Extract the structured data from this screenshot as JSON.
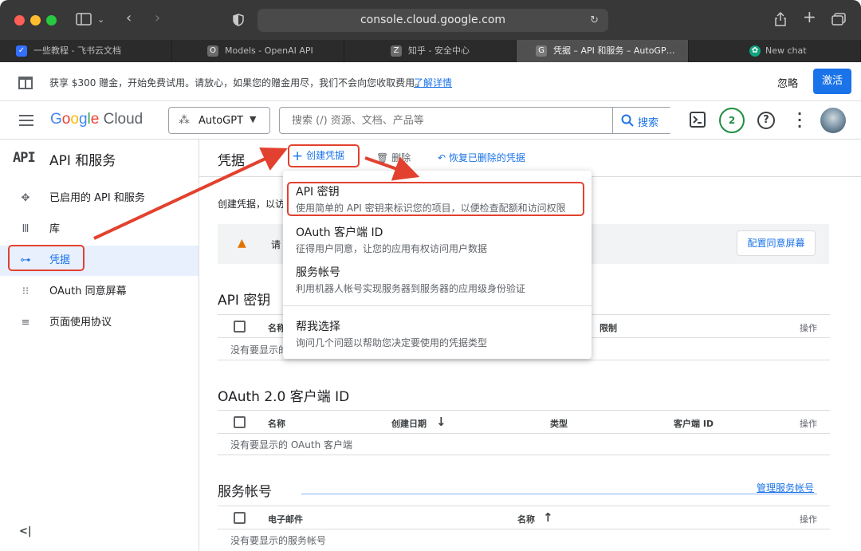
{
  "browser": {
    "url": "console.cloud.google.com",
    "tabs": [
      {
        "label": "一些教程 - 飞书云文档",
        "icon": "feishu-icon"
      },
      {
        "label": "Models - OpenAI API",
        "icon": "o-letter-icon"
      },
      {
        "label": "知乎 - 安全中心",
        "icon": "z-letter-icon"
      },
      {
        "label": "凭据 – API 和服务 – AutoGP…",
        "icon": "g-letter-icon"
      },
      {
        "label": "New chat",
        "icon": "chatgpt-icon"
      }
    ]
  },
  "promo": {
    "text": "获享 $300 赠金，开始免费试用。请放心，如果您的赠金用尽，我们不会向您收取费用。",
    "link": "了解详情",
    "dismiss": "忽略",
    "activate": "激活"
  },
  "header": {
    "logo": "Google Cloud",
    "project": "AutoGPT",
    "search_placeholder": "搜索 (/) 资源、文档、产品等",
    "search_button": "搜索",
    "notifications_count": "2"
  },
  "sidebar": {
    "api_badge": "API",
    "title": "API 和服务",
    "items": [
      {
        "label": "已启用的 API 和服务",
        "icon": "api-hub-icon"
      },
      {
        "label": "库",
        "icon": "library-icon"
      },
      {
        "label": "凭据",
        "icon": "key-icon"
      },
      {
        "label": "OAuth 同意屏幕",
        "icon": "consent-icon"
      },
      {
        "label": "页面使用协议",
        "icon": "settings-list-icon"
      }
    ],
    "collapse": "<|"
  },
  "main": {
    "title": "凭据",
    "create": "创建凭据",
    "delete": "删除",
    "restore": "恢复已删除的凭据",
    "intro": "创建凭据，以访",
    "warning_text": "请",
    "configure_consent": "配置同意屏幕",
    "api_keys": {
      "title": "API 密钥",
      "cols": [
        "名称",
        "限制",
        "操作"
      ],
      "empty": "没有要显示的"
    },
    "oauth": {
      "title": "OAuth 2.0 客户端 ID",
      "cols": [
        "名称",
        "创建日期",
        "类型",
        "客户端 ID",
        "操作"
      ],
      "empty": "没有要显示的 OAuth 客户端"
    },
    "service": {
      "title": "服务帐号",
      "manage": "管理服务帐号",
      "cols": [
        "电子邮件",
        "名称",
        "操作"
      ],
      "empty": "没有要显示的服务帐号"
    }
  },
  "menu": {
    "items": [
      {
        "title": "API 密钥",
        "desc": "使用简单的 API 密钥来标识您的项目，以便检查配额和访问权限"
      },
      {
        "title": "OAuth 客户端 ID",
        "desc": "征得用户同意，让您的应用有权访问用户数据"
      },
      {
        "title": "服务帐号",
        "desc": "利用机器人帐号实现服务器到服务器的应用级身份验证"
      },
      {
        "title": "帮我选择",
        "desc": "询问几个问题以帮助您决定要使用的凭据类型"
      }
    ]
  },
  "colors": {
    "accent": "#1a73e8",
    "annotation": "#e2412f"
  }
}
